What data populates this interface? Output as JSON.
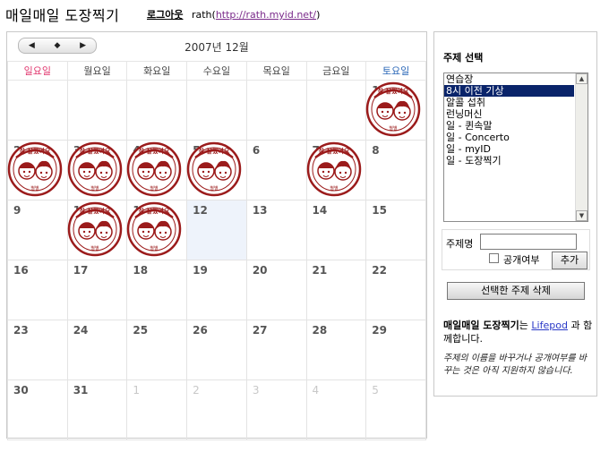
{
  "header": {
    "app_title": "매일매일 도장찍기",
    "logout_label": "로그아웃",
    "user_name": "rath(",
    "user_url": "http://rath.myid.net/",
    "user_close": ")"
  },
  "calendar": {
    "nav": {
      "prev_icon": "◀",
      "today_icon": "◆",
      "next_icon": "▶"
    },
    "month_label": "2007년 12월",
    "weekdays": [
      "일요일",
      "월요일",
      "화요일",
      "수요일",
      "목요일",
      "금요일",
      "토요일"
    ],
    "weeks": [
      [
        "",
        "",
        "",
        "",
        "",
        "",
        "1"
      ],
      [
        "2",
        "3",
        "4",
        "5",
        "6",
        "7",
        "8"
      ],
      [
        "9",
        "10",
        "11",
        "12",
        "13",
        "14",
        "15"
      ],
      [
        "16",
        "17",
        "18",
        "19",
        "20",
        "21",
        "22"
      ],
      [
        "23",
        "24",
        "25",
        "26",
        "27",
        "28",
        "29"
      ],
      [
        "30",
        "31",
        "1",
        "2",
        "3",
        "4",
        "5"
      ]
    ],
    "stamp_text": "참 잘했어요",
    "stamp_sub": "별별",
    "stamp_icon": "good-job-stamp-icon",
    "stamp_color": "#9b1b1b",
    "today_color": "#eef3fb"
  },
  "sidebar": {
    "topic_title": "주제 선택",
    "topics": [
      "연습장",
      "8시 이전 기상",
      "알콜 섭취",
      "런닝머신",
      "일 - 퀸속말",
      "일 - Concerto",
      "일 - myID",
      "일 - 도장찍기"
    ],
    "selected_index": 1,
    "scroll_up_icon": "▲",
    "scroll_down_icon": "▼",
    "topic_name_label": "주제명",
    "topic_name_value": "",
    "public_label": "공개여부",
    "add_label": "추가",
    "delete_label": "선택한 주제 삭제",
    "credit_bold": "매일매일 도장찍기",
    "credit_text1": "는 ",
    "credit_link": "Lifepod",
    "credit_text2": "과 함께합니다.",
    "notice": "주제의 이름을 바꾸거나 공개여부를 바꾸는 것은 아직 지원하지 않습니다."
  }
}
